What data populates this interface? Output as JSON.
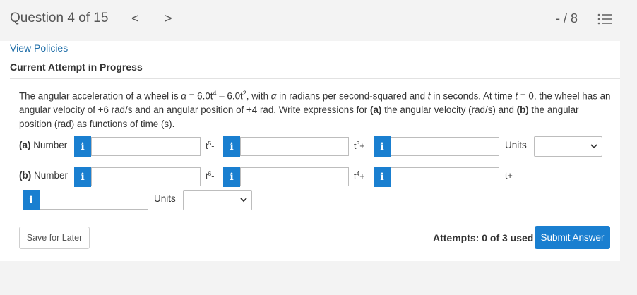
{
  "header": {
    "question_label": "Question 4 of 15",
    "prev_glyph": "<",
    "next_glyph": ">",
    "score": "- / 8"
  },
  "links": {
    "view_policies": "View Policies"
  },
  "attempt_status": "Current Attempt in Progress",
  "question": {
    "text_1": "The angular acceleration of a wheel is ",
    "alpha": "α",
    "eq_1": " = 6.0t",
    "exp_1": "4",
    "eq_2": " – 6.0t",
    "exp_2": "2",
    "text_2": ", with ",
    "text_3": " in radians per second-squared and ",
    "t_var": "t",
    "text_4": " in seconds. At time ",
    "text_5": " = 0, the wheel has an angular velocity of +6 rad/s and an angular position of +4 rad. Write expressions for ",
    "part_a_marker": "(a)",
    "text_6": " the angular velocity (rad/s) and ",
    "part_b_marker": "(b)",
    "text_7": " the angular position (rad) as functions of time (s)."
  },
  "part_a": {
    "marker": "(a)",
    "label": " Number",
    "info_glyph": "i",
    "field1_value": "",
    "suffix1_base": "t",
    "suffix1_exp": "5",
    "suffix1_op": "-",
    "field2_value": "",
    "suffix2_base": "t",
    "suffix2_exp": "3",
    "suffix2_op": "+",
    "field3_value": "",
    "units_label": "Units",
    "units_selected": ""
  },
  "part_b": {
    "marker": "(b)",
    "label": " Number",
    "info_glyph": "i",
    "field1_value": "",
    "suffix1_base": "t",
    "suffix1_exp": "6",
    "suffix1_op": "-",
    "field2_value": "",
    "suffix2_base": "t",
    "suffix2_exp": "4",
    "suffix2_op": "+",
    "field3_value": "",
    "suffix3": "t+",
    "field4_value": "",
    "units_label": "Units",
    "units_selected": ""
  },
  "footer": {
    "save_label": "Save for Later",
    "attempts": "Attempts: 0 of 3 used",
    "submit_label": "Submit Answer"
  },
  "colors": {
    "accent": "#1a7fd0",
    "link": "#1f6ea8",
    "background": "#f3f3f3",
    "panel": "#ffffff"
  },
  "icons": {
    "prev": "chevron-left-icon",
    "next": "chevron-right-icon",
    "list": "list-icon",
    "info": "info-icon",
    "dropdown": "chevron-down-icon"
  }
}
